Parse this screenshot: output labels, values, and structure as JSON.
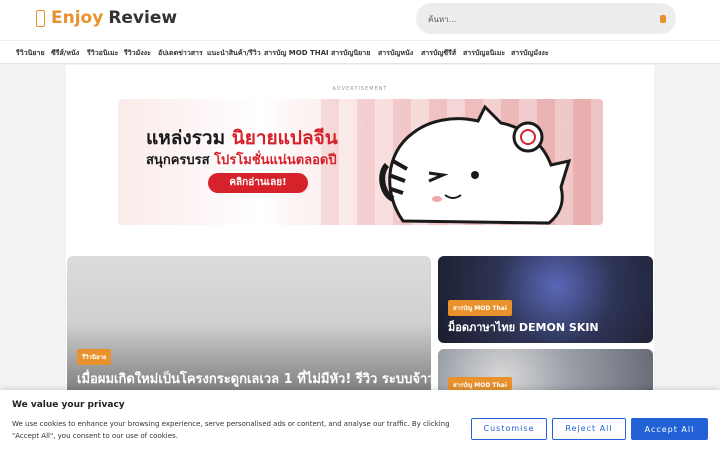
{
  "header": {
    "logo_enjoy": "Enjoy",
    "logo_review": "Review",
    "search_placeholder": "ค้นหา...",
    "brand_color": "#e8912d"
  },
  "nav": {
    "items": [
      "รีวิวนิยาย",
      "ซีรีส์/หนัง",
      "รีวิวอนิเมะ",
      "รีวิวมังงะ",
      "อัปเดตข่าวสาร",
      "แนะนำสินค้า/รีวิว",
      "สารบัญ MOD THAI",
      "สารบัญนิยาย",
      "สารบัญหนัง",
      "สารบัญซีรีส์",
      "สารบัญอนิเมะ",
      "สารบัญมังงะ"
    ]
  },
  "ad": {
    "label": "ADVERTISEMENT",
    "line1_prefix": "แหล่งรวม ",
    "line1_highlight": "นิยายแปลจีน",
    "line2_prefix": "สนุกครบรส ",
    "line2_highlight": "โปรโมชั่นแน่นตลอดปี",
    "cta": "คลิกอ่านเลย!",
    "accent_color": "#d6232b"
  },
  "featured": {
    "main": {
      "badge": "รีวิวนิยาย",
      "title": "เมื่อผมเกิดใหม่เป็นโครงกระดูกเลเวล 1 ที่ไม่มีหัว! รีวิว ระบบจ้าว"
    },
    "side": [
      {
        "badge": "สารบัญ MOD Thai",
        "title": "ม็อดภาษาไทย DEMON SKIN"
      },
      {
        "badge": "สารบัญ MOD Thai",
        "title": ""
      }
    ]
  },
  "cookie": {
    "title": "We value your privacy",
    "text": "We use cookies to enhance your browsing experience, serve personalised ads or content, and analyse our traffic. By clicking \"Accept All\", you consent to our use of cookies.",
    "customise": "Customise",
    "reject": "Reject All",
    "accept": "Accept All",
    "button_color": "#2262d6"
  }
}
